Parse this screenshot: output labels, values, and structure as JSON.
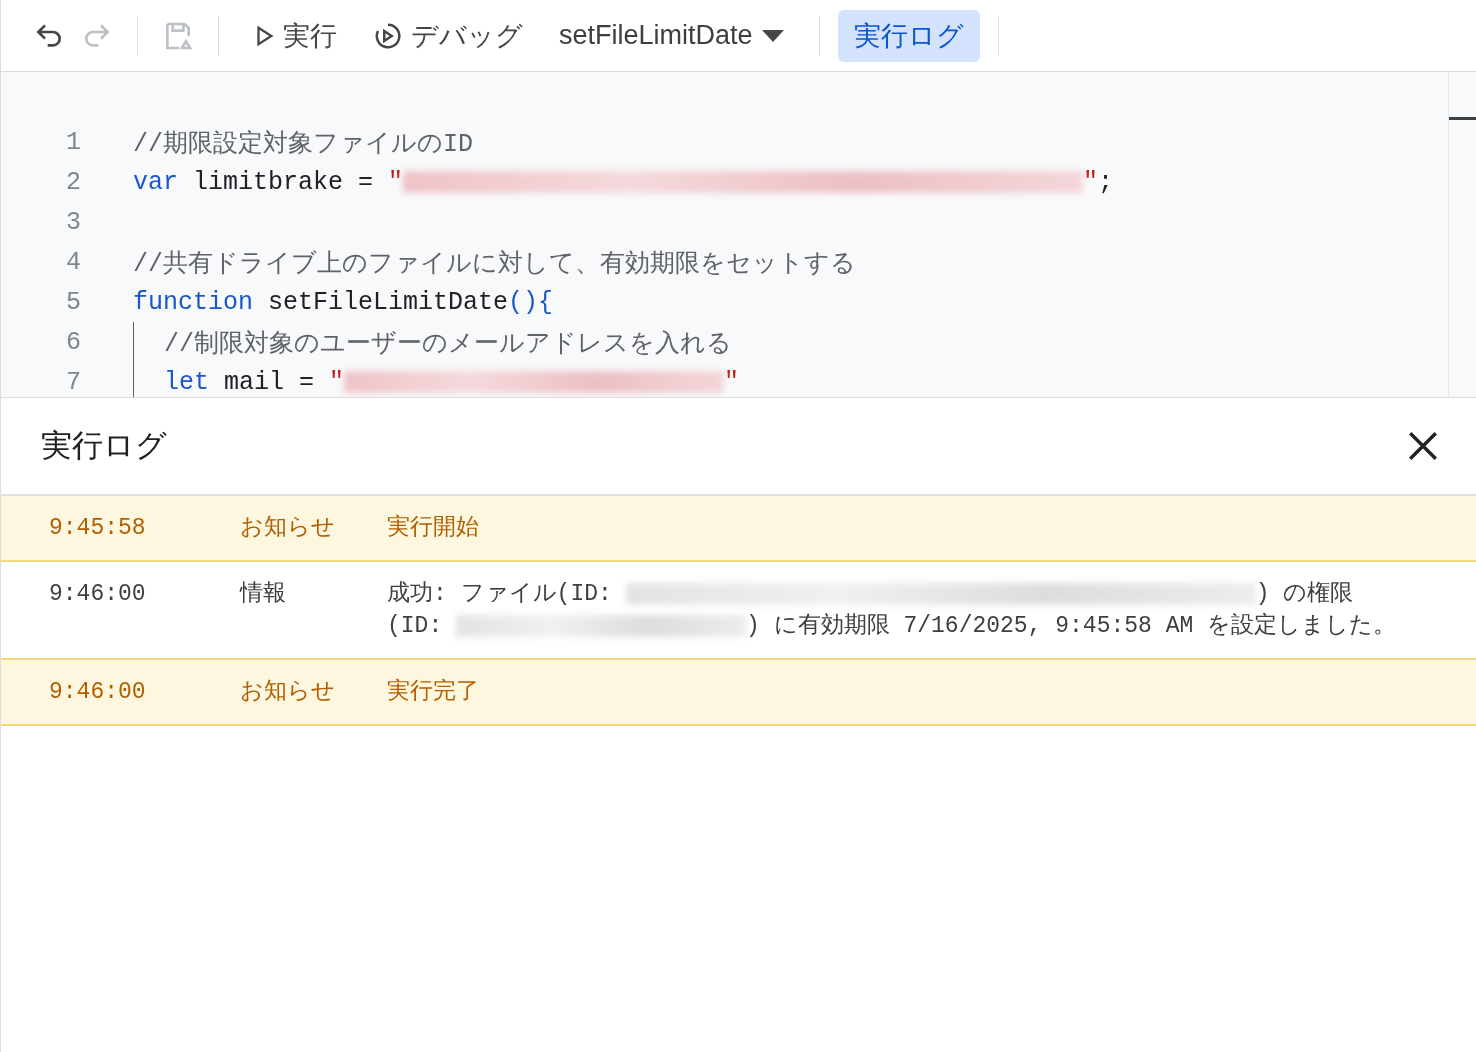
{
  "toolbar": {
    "items": [
      {
        "kind": "undo",
        "disabled": false
      },
      {
        "kind": "redo",
        "disabled": true
      },
      {
        "kind": "save",
        "disabled": true
      },
      {
        "kind": "run",
        "label": "実行"
      },
      {
        "kind": "debug",
        "label": "デバッグ"
      },
      {
        "kind": "function-select",
        "label": "setFileLimitDate"
      },
      {
        "kind": "log",
        "label": "実行ログ",
        "selected": true
      }
    ]
  },
  "editor": {
    "lines": [
      {
        "number": "1",
        "tokens": [
          {
            "kind": "comment",
            "text": "//期限設定対象ファイルのID"
          }
        ]
      },
      {
        "number": "2",
        "tokens": [
          {
            "kind": "keyword",
            "text": "var"
          },
          {
            "kind": "plain",
            "text": " limitbrake = "
          },
          {
            "kind": "string",
            "text": "\""
          },
          {
            "kind": "redacted"
          },
          {
            "kind": "string",
            "text": "\""
          },
          {
            "kind": "plain",
            "text": ";"
          }
        ]
      },
      {
        "number": "3"
      },
      {
        "number": "4",
        "tokens": [
          {
            "kind": "comment",
            "text": "//共有ドライブ上のファイルに対して、有効期限をセットする"
          }
        ]
      },
      {
        "number": "5",
        "tokens": [
          {
            "kind": "keyword",
            "text": "function"
          },
          {
            "kind": "plain",
            "text": " setFileLimitDate"
          },
          {
            "kind": "bracket",
            "text": "(){"
          }
        ],
        "children": [
          {
            "number": "6",
            "tokens": [
              {
                "kind": "comment",
                "text": "//制限対象のユーザーのメールアドレスを入れる"
              }
            ]
          },
          {
            "number": "7",
            "tokens": [
              {
                "kind": "keyword",
                "text": "let"
              },
              {
                "kind": "plain",
                "text": " mail = "
              },
              {
                "kind": "string",
                "text": "\""
              },
              {
                "kind": "redacted"
              },
              {
                "kind": "string",
                "text": "\""
              }
            ]
          }
        ]
      }
    ]
  },
  "log_panel": {
    "title": "実行ログ",
    "rows": [
      {
        "kind": "notice",
        "time": "9:45:58",
        "level": "お知らせ",
        "message": [
          [
            {
              "kind": "text",
              "text": "実行開始"
            }
          ]
        ]
      },
      {
        "kind": "info",
        "time": "9:46:00",
        "level": "情報",
        "message": [
          [
            {
              "kind": "text",
              "text": "成功: ファイル(ID: "
            },
            {
              "kind": "redacted"
            },
            {
              "kind": "text",
              "text": ") の権限"
            }
          ],
          [
            {
              "kind": "text",
              "text": "(ID: "
            },
            {
              "kind": "redacted"
            },
            {
              "kind": "text",
              "text": ") に有効期限 7/16/2025, 9:45:58 AM を設定しました。"
            }
          ]
        ]
      },
      {
        "kind": "notice",
        "time": "9:46:00",
        "level": "お知らせ",
        "message": [
          [
            {
              "kind": "text",
              "text": "実行完了"
            }
          ]
        ]
      }
    ]
  }
}
